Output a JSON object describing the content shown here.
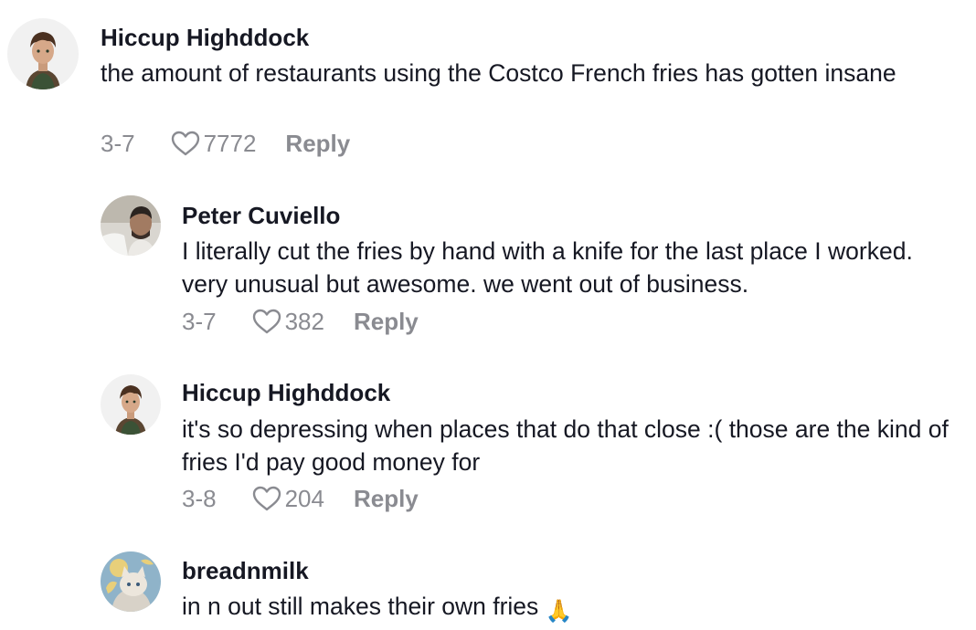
{
  "comments": [
    {
      "username": "Hiccup Highddock",
      "text": "the amount of restaurants using the Costco French fries has gotten insane",
      "date": "3-7",
      "likes": "7772",
      "reply_label": "Reply",
      "avatar_icon": "animated-character-avatar"
    },
    {
      "username": "Peter Cuviello",
      "text": "I literally cut the fries by hand with a knife for the last place I worked. very unusual but awesome. we went out of business.",
      "date": "3-7",
      "likes": "382",
      "reply_label": "Reply",
      "avatar_icon": "photo-avatar"
    },
    {
      "username": "Hiccup Highddock",
      "text": "it's so depressing when places that do that close :( those are the kind of fries I'd pay good money for",
      "date": "3-8",
      "likes": "204",
      "reply_label": "Reply",
      "avatar_icon": "animated-character-avatar"
    },
    {
      "username": "breadnmilk",
      "text": "in n out still makes their own fries",
      "emoji": "🙏",
      "avatar_icon": "cat-character-avatar"
    }
  ],
  "colors": {
    "text": "#161823",
    "meta": "#8a8b91"
  }
}
